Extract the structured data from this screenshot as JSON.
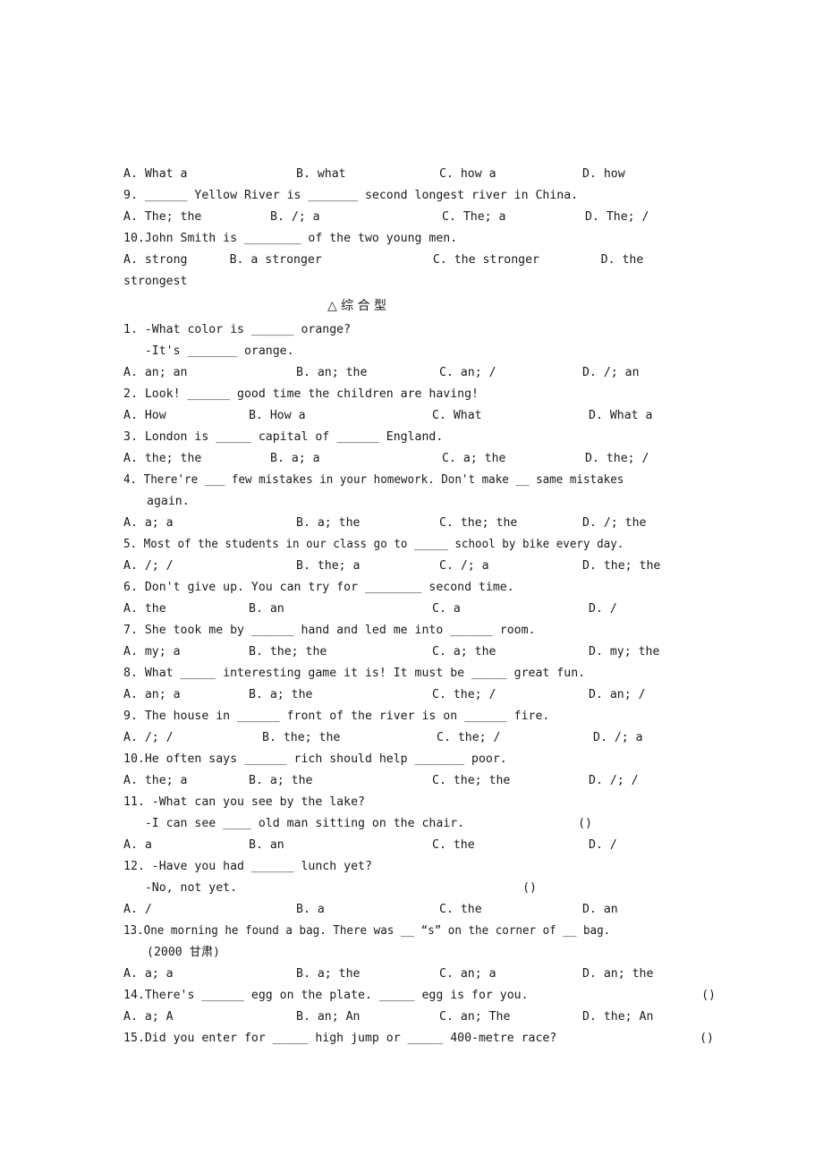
{
  "document": {
    "section_header": "△ 综 合 型",
    "blocks": [
      {
        "kind": "options",
        "name": "options-q8-prev",
        "width_variant": "w-c",
        "items": [
          "A. What a",
          "B. what",
          "C. how a",
          "D. how"
        ]
      },
      {
        "kind": "question",
        "name": "question-9",
        "lines": [
          "9. ______ Yellow River is _______ second longest river in China."
        ]
      },
      {
        "kind": "options",
        "name": "options-q9",
        "width_variant": "w-a",
        "items": [
          "A. The; the",
          "B. /; a",
          "C. The; a",
          "D. The; /"
        ]
      },
      {
        "kind": "question",
        "name": "question-10",
        "lines": [
          "10.John Smith is ________ of the two young men."
        ]
      },
      {
        "kind": "options",
        "name": "options-q10",
        "width_variant": "w-d",
        "items": [
          "A. strong",
          "B. a stronger",
          "C. the stronger",
          "D. the"
        ]
      },
      {
        "kind": "text",
        "name": "question-10-wrap",
        "lines": [
          "strongest"
        ]
      },
      {
        "kind": "section",
        "name": "section-header"
      },
      {
        "kind": "question",
        "name": "question-1",
        "lines": [
          "1. -What color is ______ orange?",
          "   -It's _______ orange."
        ]
      },
      {
        "kind": "options",
        "name": "options-q1",
        "width_variant": "w-c",
        "items": [
          "A. an; an",
          "B. an; the",
          "C. an; /",
          "D. /; an"
        ]
      },
      {
        "kind": "question",
        "name": "question-2",
        "lines": [
          "2. Look! ______ good time the children are having!"
        ]
      },
      {
        "kind": "options",
        "name": "options-q2",
        "width_variant": "w-b",
        "items": [
          "A. How",
          "B. How a",
          "C. What",
          "D. What a"
        ]
      },
      {
        "kind": "question",
        "name": "question-3",
        "lines": [
          "3. London is _____ capital of ______ England."
        ]
      },
      {
        "kind": "options",
        "name": "options-q3",
        "width_variant": "w-a",
        "items": [
          "A. the; the",
          "B. a; a",
          "C. a; the",
          "D. the; /"
        ]
      },
      {
        "kind": "question-condensed",
        "name": "question-4",
        "lines": [
          "4. There're ___ few mistakes in your homework. Don't make __ same mistakes"
        ]
      },
      {
        "kind": "text-indent",
        "name": "question-4-wrap",
        "lines": [
          "again."
        ]
      },
      {
        "kind": "options",
        "name": "options-q4",
        "width_variant": "w-c",
        "items": [
          "A. a; a",
          "B. a; the",
          "C. the; the",
          "D. /; the"
        ]
      },
      {
        "kind": "question-condensed",
        "name": "question-5",
        "lines": [
          "5. Most of the students in our class go to _____ school by bike every day."
        ]
      },
      {
        "kind": "options",
        "name": "options-q5",
        "width_variant": "w-c",
        "items": [
          "A. /; /",
          "B. the; a",
          "C. /; a",
          "D. the; the"
        ]
      },
      {
        "kind": "question",
        "name": "question-6",
        "lines": [
          "6. Don't give up. You can try for ________ second time."
        ]
      },
      {
        "kind": "options",
        "name": "options-q6",
        "width_variant": "w-b",
        "items": [
          "A. the",
          "B. an",
          "C. a",
          "D. /"
        ]
      },
      {
        "kind": "question",
        "name": "question-7",
        "lines": [
          "7. She took me by ______ hand and led me into ______ room."
        ]
      },
      {
        "kind": "options",
        "name": "options-q7",
        "width_variant": "w-b",
        "items": [
          "A. my; a",
          "B. the; the",
          "C. a; the",
          "D. my; the"
        ]
      },
      {
        "kind": "question",
        "name": "question-8",
        "lines": [
          "8. What _____ interesting game it is! It must be _____ great fun."
        ]
      },
      {
        "kind": "options",
        "name": "options-q8",
        "width_variant": "w-b",
        "items": [
          "A. an; a",
          "B. a; the",
          "C. the; /",
          "D. an; /"
        ]
      },
      {
        "kind": "question",
        "name": "question-9b",
        "lines": [
          "9. The house in ______ front of the river is on ______ fire."
        ]
      },
      {
        "kind": "options",
        "name": "options-q9b",
        "width_variant": "w-e",
        "items": [
          "A. /; /",
          "B. the; the",
          "C. the; /",
          "D. /; a"
        ]
      },
      {
        "kind": "question",
        "name": "question-10b",
        "lines": [
          "10.He often says ______ rich should help _______ poor."
        ]
      },
      {
        "kind": "options",
        "name": "options-q10b",
        "width_variant": "w-b",
        "items": [
          "A. the; a",
          "B. a; the",
          "C. the; the",
          "D. /; /"
        ]
      },
      {
        "kind": "question",
        "name": "question-11",
        "lines": [
          "11. -What can you see by the lake?"
        ]
      },
      {
        "kind": "question-tail",
        "name": "question-11-line2",
        "text": "   -I can see ____ old man sitting on the chair.",
        "tail": "()",
        "tail_variant": "t-a"
      },
      {
        "kind": "options",
        "name": "options-q11",
        "width_variant": "w-b",
        "items": [
          "A. a",
          "B. an",
          "C. the",
          "D. /"
        ]
      },
      {
        "kind": "question",
        "name": "question-12",
        "lines": [
          "12. -Have you had ______ lunch yet?"
        ]
      },
      {
        "kind": "question-tail",
        "name": "question-12-line2",
        "text": "   -No, not yet.",
        "tail": "()",
        "tail_variant": "t-b"
      },
      {
        "kind": "options",
        "name": "options-q12",
        "width_variant": "w-c",
        "items": [
          "A. /",
          "B. a",
          "C. the",
          "D. an"
        ]
      },
      {
        "kind": "question-condensed",
        "name": "question-13",
        "lines": [
          "13.One morning he found a bag. There was __ “s” on the corner of __ bag."
        ]
      },
      {
        "kind": "text-indent",
        "name": "question-13-source",
        "lines": [
          "(2000 甘肃)"
        ]
      },
      {
        "kind": "options",
        "name": "options-q13",
        "width_variant": "w-c",
        "items": [
          "A. a; a",
          "B. a; the",
          "C. an; a",
          "D. an; the"
        ]
      },
      {
        "kind": "question-tail",
        "name": "question-14",
        "text": "14.There's ______ egg on the plate. _____ egg is for you.",
        "tail": "()",
        "tail_variant": "t-c"
      },
      {
        "kind": "options",
        "name": "options-q14",
        "width_variant": "w-c",
        "items": [
          "A. a; A",
          "B. an; An",
          "C. an; The",
          "D. the; An"
        ]
      },
      {
        "kind": "question-tail",
        "name": "question-15",
        "text": "15.Did you enter for _____ high jump or _____ 400-metre race?",
        "tail": "()",
        "tail_variant": "t-d"
      }
    ]
  }
}
